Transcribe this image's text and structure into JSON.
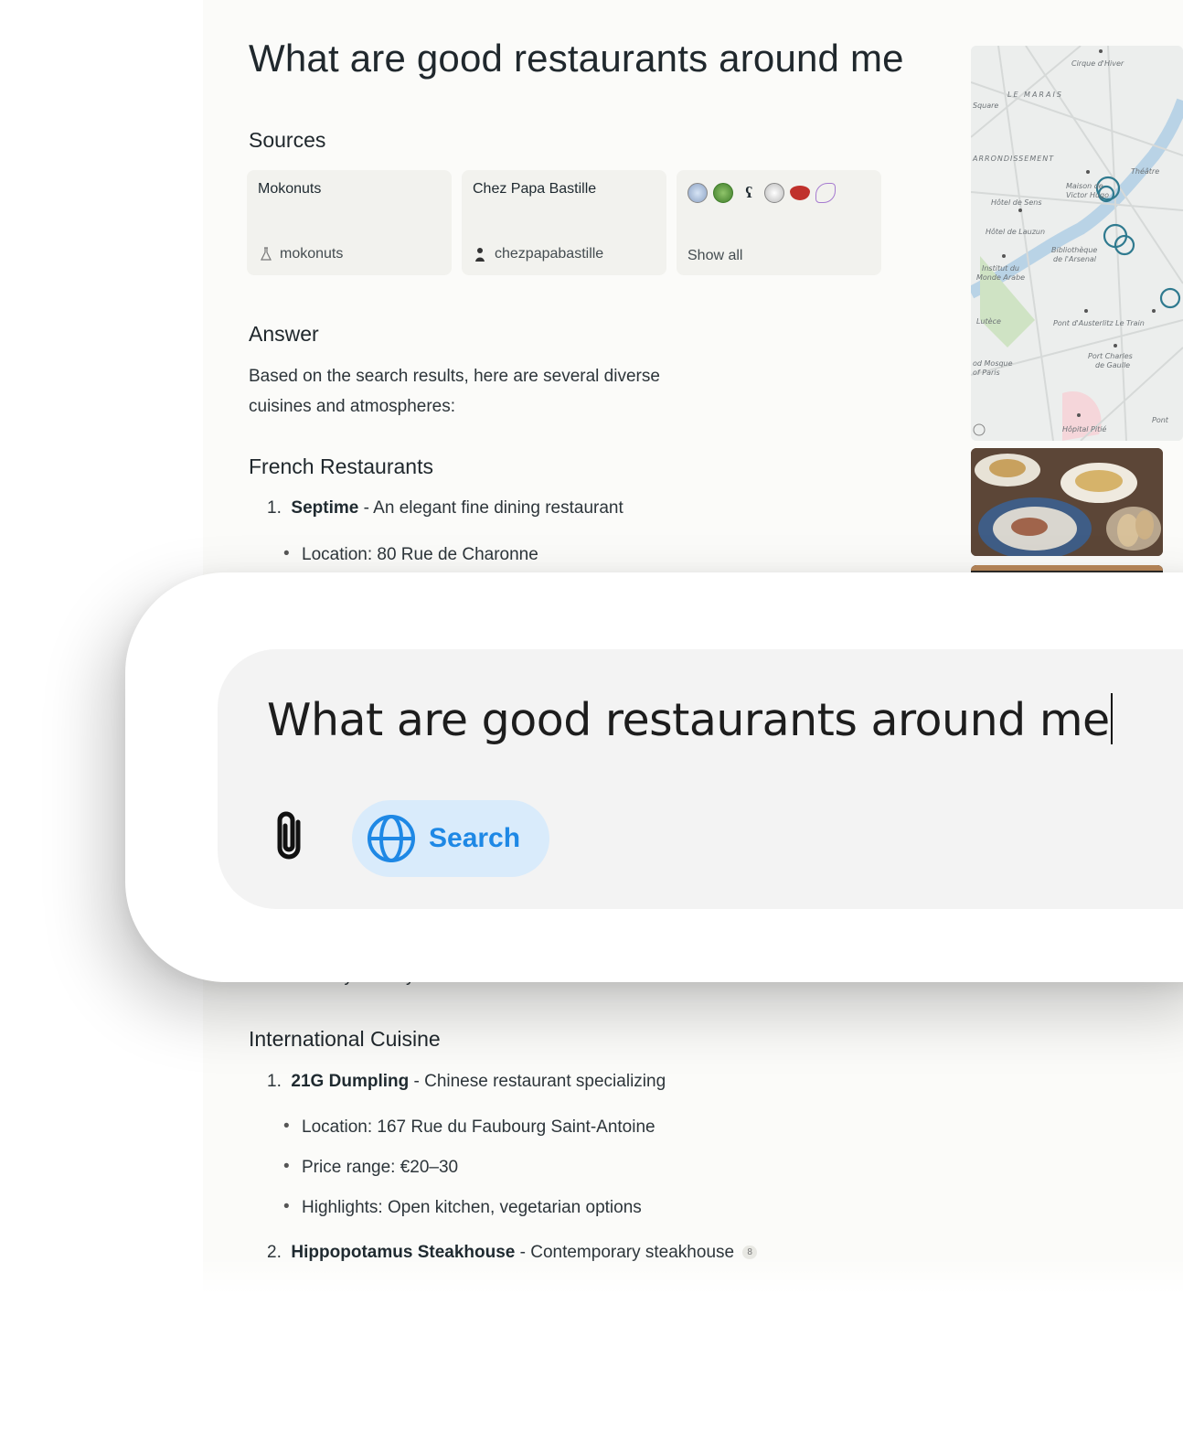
{
  "answer_page": {
    "title": "What are good restaurants around me",
    "sources_heading": "Sources",
    "sources": [
      {
        "title": "Mokonuts",
        "domain": "mokonuts"
      },
      {
        "title": "Chez Papa Bastille",
        "domain": "chezpapabastille"
      }
    ],
    "show_all_label": "Show all",
    "answer_heading": "Answer",
    "answer_text": "Based on the search results, here are several diverse cuisines and atmospheres:",
    "sections": [
      {
        "heading": "French Restaurants",
        "items": [
          {
            "num": "1.",
            "name": "Septime",
            "desc": "- An elegant fine dining restaurant",
            "bullets": [
              "Location: 80 Rue de Charonne"
            ]
          }
        ],
        "partial_line": "Family-friendly with kids' menu"
      },
      {
        "heading": "International Cuisine",
        "items": [
          {
            "num": "1.",
            "name": "21G Dumpling",
            "desc": "- Chinese restaurant specializing",
            "bullets": [
              "Location: 167 Rue du Faubourg Saint-Antoine",
              "Price range: €20–30",
              "Highlights: Open kitchen, vegetarian options"
            ]
          },
          {
            "num": "2.",
            "name": "Hippopotamus Steakhouse",
            "desc": "- Contemporary steakhouse",
            "citation": "8"
          }
        ]
      }
    ]
  },
  "composer": {
    "input_value": "What are good restaurants around me",
    "attach_icon": "paperclip-icon",
    "search_label": "Search",
    "search_icon": "globe-icon",
    "accent_color": "#1e88e5"
  }
}
